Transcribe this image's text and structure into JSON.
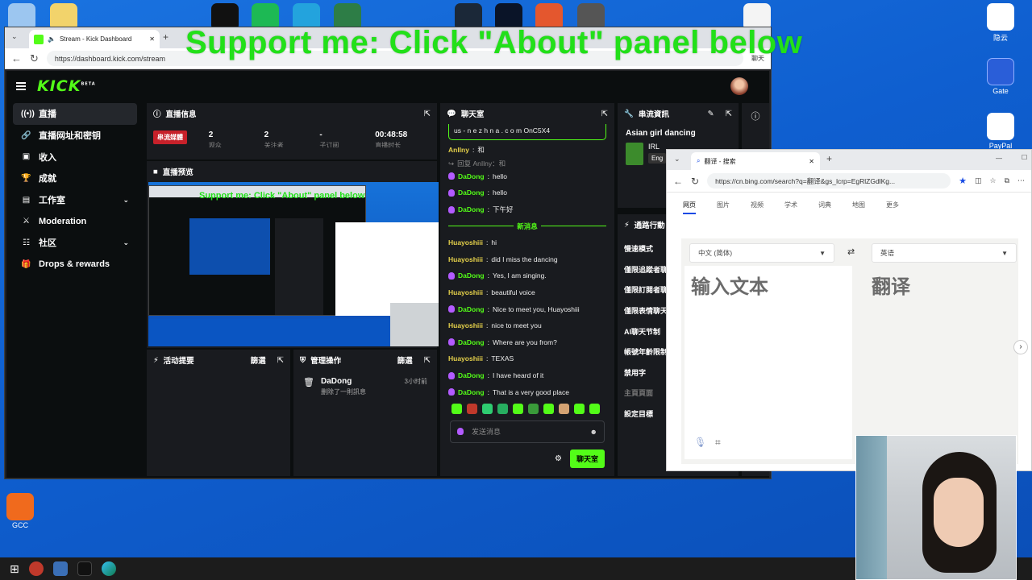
{
  "overlay": {
    "banner": "Support me: Click \"About\" panel below"
  },
  "browser": {
    "tab_title": "Stream - Kick Dashboard",
    "url": "https://dashboard.kick.com/stream",
    "chat_label": "聊天"
  },
  "sidebar": {
    "items": [
      {
        "label": "直播",
        "icon": "broadcast-icon",
        "active": true
      },
      {
        "label": "直播网址和密钥",
        "icon": "link-icon"
      },
      {
        "label": "收入",
        "icon": "money-icon"
      },
      {
        "label": "成就",
        "icon": "trophy-icon"
      },
      {
        "label": "工作室",
        "icon": "studio-icon",
        "expandable": true
      },
      {
        "label": "Moderation",
        "icon": "shield-icon"
      },
      {
        "label": "社区",
        "icon": "community-icon",
        "expandable": true
      },
      {
        "label": "Drops & rewards",
        "icon": "gift-icon"
      }
    ]
  },
  "stream_info": {
    "title": "直播信息",
    "badge": "串流媒體",
    "stats": [
      {
        "value": "2",
        "sub": "观众"
      },
      {
        "value": "2",
        "sub": "关注者"
      },
      {
        "value": "-",
        "sub": "子订阅"
      },
      {
        "value": "00:48:58",
        "sub": "直播时长"
      }
    ]
  },
  "preview": {
    "title": "直播预览",
    "banner": "Support me: Click \"About\" panel below"
  },
  "activity": {
    "title": "活动提要",
    "filter": "篩選"
  },
  "mod_actions": {
    "title": "管理操作",
    "filter": "篩選",
    "entry_user": "DaDong",
    "entry_text": "删除了一則訊息",
    "entry_time": "3小时前"
  },
  "chat": {
    "title": "聊天室",
    "top_partial": "us - n e z h n a . c o m OnC5X4",
    "messages": [
      {
        "user": "AnIlny",
        "text": "和",
        "color": "yellow",
        "mic": false
      },
      {
        "reply": "回复 AnIlny：和"
      },
      {
        "user": "DaDong",
        "text": "hello",
        "color": "green",
        "mic": true
      },
      {
        "user": "DaDong",
        "text": "hello",
        "color": "green",
        "mic": true
      },
      {
        "user": "DaDong",
        "text": "下午好",
        "color": "green",
        "mic": true
      },
      {
        "divider": "新消息"
      },
      {
        "user": "Huayoshiii",
        "text": "hi",
        "color": "yellow",
        "mic": false
      },
      {
        "user": "Huayoshiii",
        "text": "did I miss the dancing",
        "color": "yellow",
        "mic": false
      },
      {
        "user": "DaDong",
        "text": "Yes, I am singing.",
        "color": "green",
        "mic": true
      },
      {
        "user": "Huayoshiii",
        "text": "beautiful voice",
        "color": "yellow",
        "mic": false
      },
      {
        "user": "DaDong",
        "text": "Nice to meet you, Huayoshiii",
        "color": "green",
        "mic": true
      },
      {
        "user": "Huayoshiii",
        "text": "nice to meet you",
        "color": "yellow",
        "mic": false
      },
      {
        "user": "DaDong",
        "text": "Where are you from?",
        "color": "green",
        "mic": true
      },
      {
        "user": "Huayoshiii",
        "text": "TEXAS",
        "color": "yellow",
        "mic": false
      },
      {
        "user": "DaDong",
        "text": "I have heard of it",
        "color": "green",
        "mic": true
      },
      {
        "user": "DaDong",
        "text": "That is a very good place",
        "color": "green",
        "mic": true
      }
    ],
    "input_placeholder": "发送消息",
    "send_button": "聊天室"
  },
  "stream_details": {
    "title": "串流資訊",
    "stream_title": "Asian girl dancing",
    "category": "IRL",
    "language": "Eng"
  },
  "chat_settings": {
    "title": "通路行動",
    "items": [
      "慢速模式",
      "僅限追蹤者聊",
      "僅限訂閱者聊",
      "僅限表情聊天",
      "AI聊天节制",
      "帳號年齡限制",
      "禁用字",
      "主頁頁面",
      "設定目標"
    ]
  },
  "bing": {
    "tab_title": "翻译 - 搜索",
    "url": "https://cn.bing.com/search?q=翻译&gs_lcrp=EgRlZGdlKg...",
    "nav": [
      "网页",
      "图片",
      "视频",
      "学术",
      "词典",
      "地图",
      "更多"
    ],
    "source_lang": "中文 (简体)",
    "target_lang": "英语",
    "input_placeholder": "输入文本",
    "output_placeholder": "翻译"
  },
  "desktop_icons": {
    "right": [
      {
        "label": "隐云"
      },
      {
        "label": "Gate"
      },
      {
        "label": "PayPal"
      }
    ],
    "left_bottom": {
      "label": "GCC"
    }
  }
}
